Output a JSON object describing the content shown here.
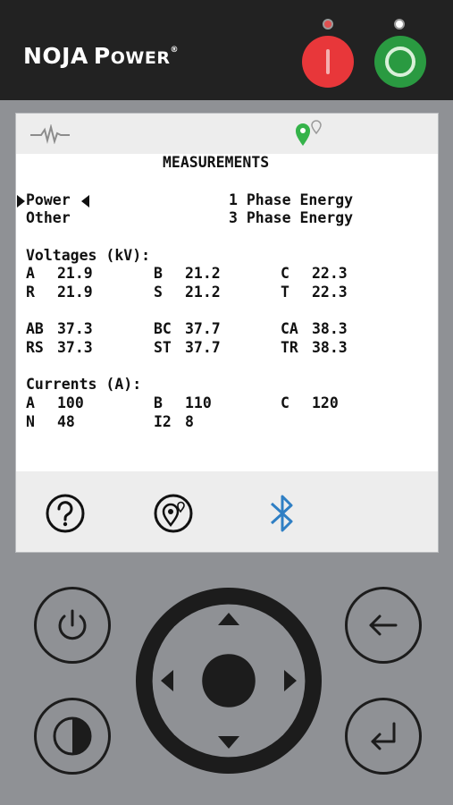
{
  "brand": {
    "name_big_1": "NOJA",
    "name_big_2": "P",
    "name_small": "OWER",
    "registered": "®"
  },
  "colors": {
    "trip": "#e8373a",
    "close": "#2a9a41",
    "bluetooth": "#2f7fc4",
    "gps": "#35b34a",
    "panel": "#8f9195",
    "header": "#222222"
  },
  "status_icons": [
    "waveform-icon",
    "gps-location-icon"
  ],
  "screen": {
    "title": "MEASUREMENTS",
    "menu": [
      {
        "left": "Power",
        "right": "1 Phase Energy"
      },
      {
        "left": "Other",
        "right": "3 Phase Energy"
      }
    ],
    "voltages": {
      "heading": "Voltages (kV):",
      "rows": [
        [
          {
            "label": "A",
            "value": "21.9"
          },
          {
            "label": "B",
            "value": "21.2"
          },
          {
            "label": "C",
            "value": "22.3"
          }
        ],
        [
          {
            "label": "R",
            "value": "21.9"
          },
          {
            "label": "S",
            "value": "21.2"
          },
          {
            "label": "T",
            "value": "22.3"
          }
        ],
        [
          {
            "label": "AB",
            "value": "37.3"
          },
          {
            "label": "BC",
            "value": "37.7"
          },
          {
            "label": "CA",
            "value": "38.3"
          }
        ],
        [
          {
            "label": "RS",
            "value": "37.3"
          },
          {
            "label": "ST",
            "value": "37.7"
          },
          {
            "label": "TR",
            "value": "38.3"
          }
        ]
      ]
    },
    "currents": {
      "heading": "Currents (A):",
      "rows": [
        [
          {
            "label": "A",
            "value": "100"
          },
          {
            "label": "B",
            "value": "110"
          },
          {
            "label": "C",
            "value": "120"
          }
        ],
        [
          {
            "label": "N",
            "value": "48"
          },
          {
            "label": "I2",
            "value": "8"
          }
        ]
      ]
    }
  },
  "bottom_icons": [
    "help-icon",
    "location-pin-icon",
    "bluetooth-icon"
  ],
  "keypad": [
    "power-button",
    "contrast-button",
    "up-arrow",
    "down-arrow",
    "left-arrow",
    "right-arrow",
    "back-button",
    "enter-button"
  ]
}
